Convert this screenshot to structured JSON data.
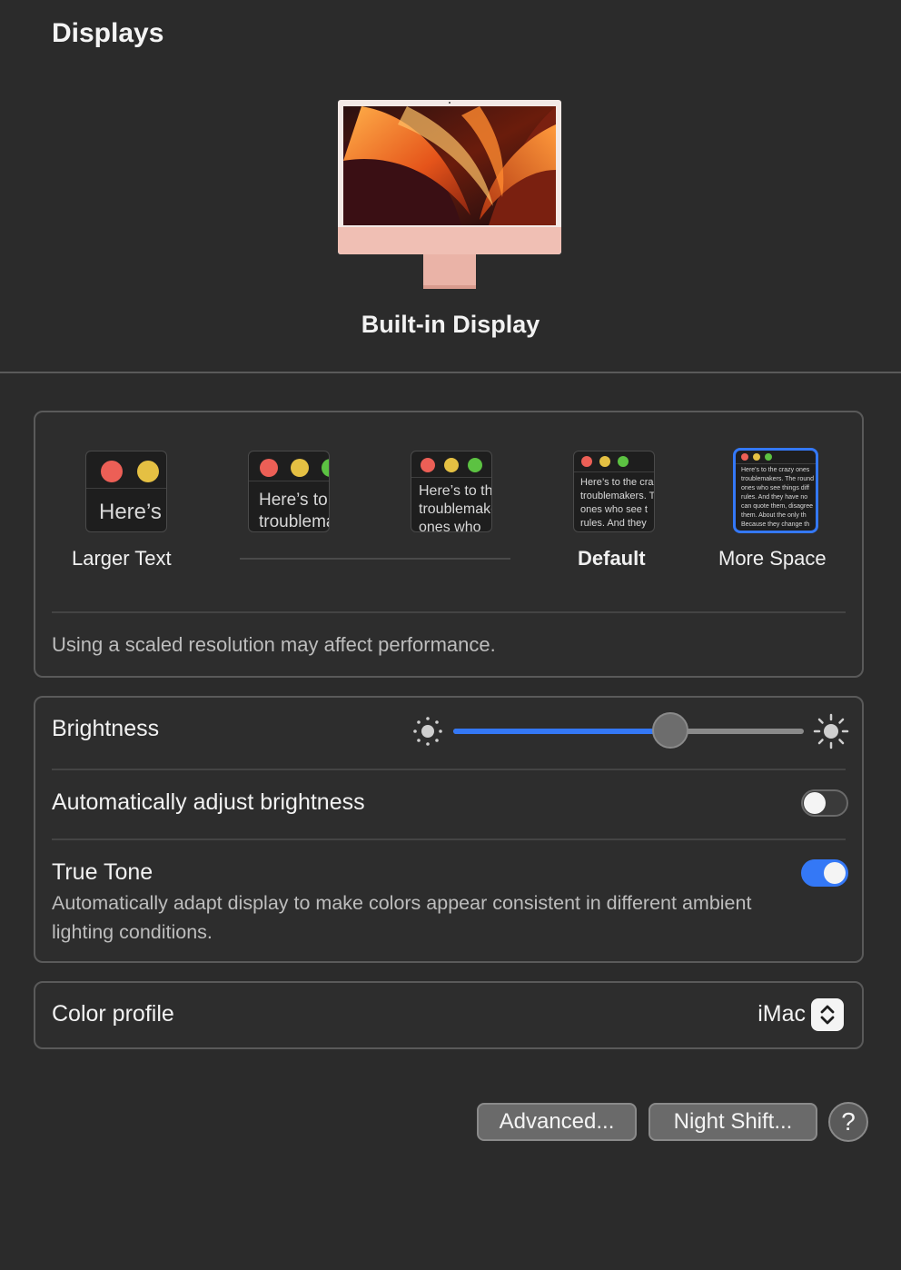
{
  "header": {
    "title": "Displays"
  },
  "display": {
    "name": "Built-in Display"
  },
  "resolution": {
    "options": [
      {
        "label": "Larger Text",
        "preview": "Here’s",
        "selected": false
      },
      {
        "label": "",
        "preview": "Here’s to the\ntroublemakers",
        "selected": false
      },
      {
        "label": "",
        "preview": "Here’s to the\ntroublemakers\nones who",
        "selected": false
      },
      {
        "label": "Default",
        "preview": "Here’s to the crazy\ntroublemakers. The\nones who see t\nrules. And they",
        "selected": false
      },
      {
        "label": "More Space",
        "preview": "Here's to the crazy ones\ntroublemakers. The round\nones who see things diff\nrules. And they have no\ncan quote them, disagree\nthem. About the only th\nBecause they change th",
        "selected": true
      }
    ],
    "note": "Using a scaled resolution may affect performance."
  },
  "brightness": {
    "label": "Brightness",
    "level": 0.62,
    "auto_label": "Automatically adjust brightness",
    "auto_on": false,
    "true_tone_label": "True Tone",
    "true_tone_desc": "Automatically adapt display to make colors appear consistent in different ambient lighting conditions.",
    "true_tone_on": true
  },
  "color_profile": {
    "label": "Color profile",
    "value": "iMac"
  },
  "buttons": {
    "advanced": "Advanced...",
    "night_shift": "Night Shift...",
    "help": "?"
  },
  "colors": {
    "accent": "#3478f6",
    "background": "#2b2b2b",
    "traffic_red": "#ec5f56",
    "traffic_yellow": "#e5c043",
    "traffic_green": "#5cc242"
  }
}
